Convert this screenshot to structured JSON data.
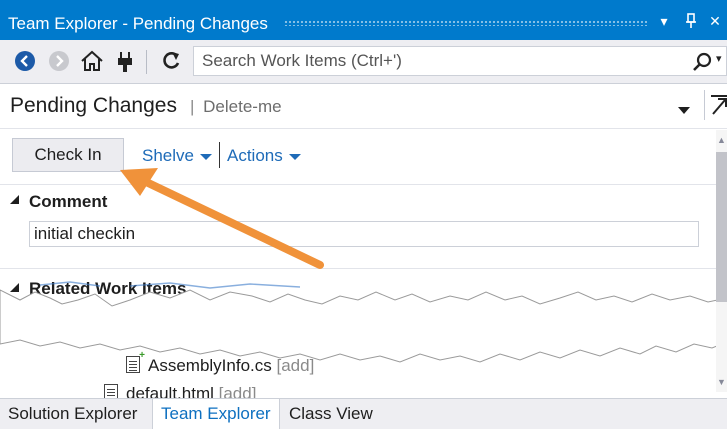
{
  "window": {
    "title": "Team Explorer - Pending Changes"
  },
  "toolbar": {
    "search_placeholder": "Search Work Items (Ctrl+')"
  },
  "header": {
    "title": "Pending Changes",
    "separator": "|",
    "subtitle": "Delete-me"
  },
  "actions": {
    "check_in_label": "Check In",
    "shelve_label": "Shelve",
    "actions_label": "Actions"
  },
  "comment_section": {
    "title": "Comment",
    "value": "initial checkin"
  },
  "related_section": {
    "title": "Related Work Items"
  },
  "files": [
    {
      "name": "AssemblyInfo.cs",
      "status": "[add]"
    },
    {
      "name": "default.html",
      "status": "[add]"
    }
  ],
  "tabs": [
    {
      "label": "Solution Explorer"
    },
    {
      "label": "Team Explorer"
    },
    {
      "label": "Class View"
    }
  ],
  "colors": {
    "title_bar": "#007acc",
    "link": "#1e6bb8",
    "active_tab_text": "#0e70c0",
    "annotation_arrow": "#f0923a"
  },
  "icons": {
    "back": "back-icon",
    "forward": "forward-icon",
    "home": "home-icon",
    "connect": "connect-plug-icon",
    "refresh": "refresh-icon",
    "search": "search-icon"
  }
}
